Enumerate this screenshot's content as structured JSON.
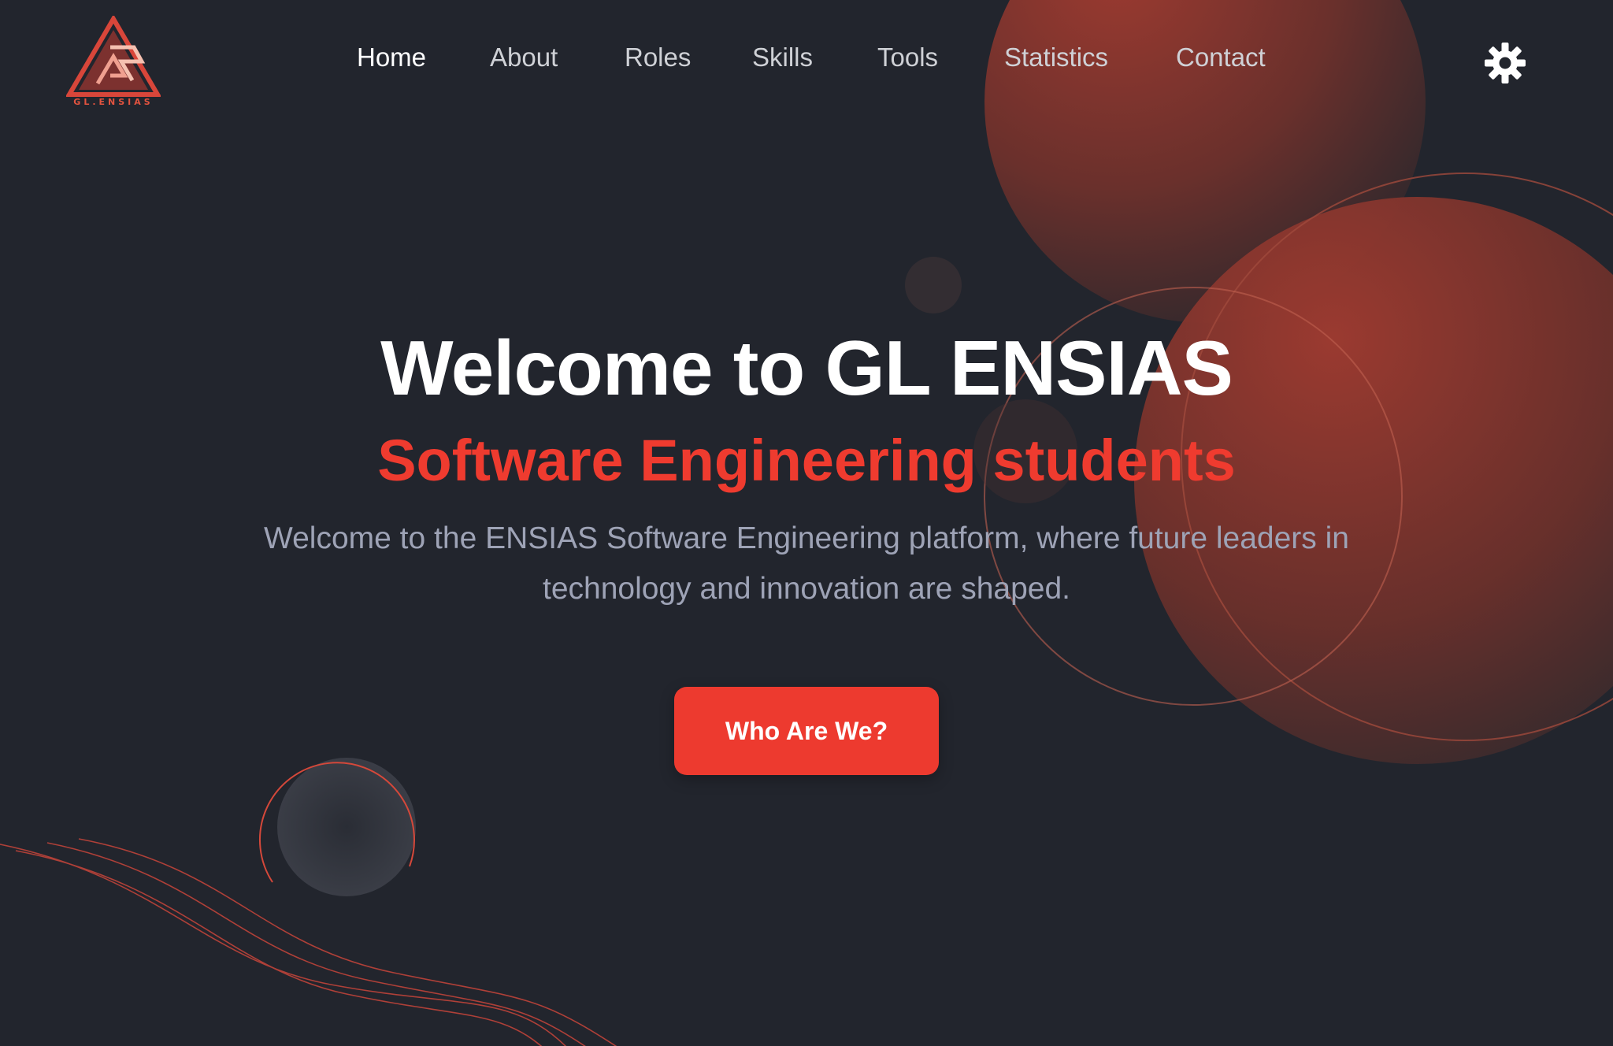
{
  "brand": {
    "logo_text": "GL.ENSIAS",
    "accent_color": "#ef3b2f"
  },
  "nav": {
    "items": [
      {
        "label": "Home",
        "active": true
      },
      {
        "label": "About"
      },
      {
        "label": "Roles"
      },
      {
        "label": "Skills"
      },
      {
        "label": "Tools"
      },
      {
        "label": "Statistics"
      },
      {
        "label": "Contact"
      }
    ],
    "settings_icon": "gear-icon"
  },
  "hero": {
    "title": "Welcome to GL ENSIAS",
    "subtitle": "Software Engineering students",
    "description": "Welcome to the ENSIAS Software Engineering platform, where future leaders in technology and innovation are shaped.",
    "cta_label": "Who Are We?"
  },
  "colors": {
    "background": "#22252d",
    "title": "#ffffff",
    "subtitle": "#ef3b2f",
    "description": "#9ea3b6",
    "button": "#ed3a2f"
  }
}
